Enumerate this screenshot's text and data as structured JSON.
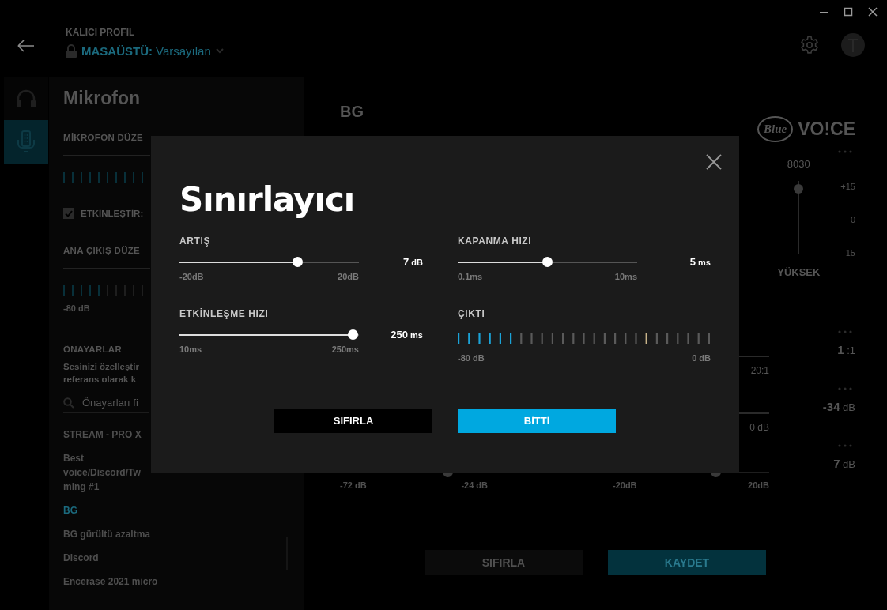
{
  "header": {
    "profile_label": "KALICI PROFIL",
    "profile_prefix": "MASAÜSTÜ:",
    "profile_name": "Varsayılan"
  },
  "nav": [
    {
      "kind": "headphones",
      "selected": false
    },
    {
      "kind": "microphone",
      "selected": true
    }
  ],
  "left_panel": {
    "title": "Mikrofon",
    "mic_level_label": "MİKROFON DÜZE",
    "enable": {
      "label": "ETKİNLEŞTİR:",
      "checked": true
    },
    "output_label": "ANA ÇIKIŞ DÜZE",
    "output_min": "-80 dB",
    "presets_title": "ÖNAYARLAR",
    "presets_description": [
      "Sesinizi özelleştir",
      "referans olarak k"
    ],
    "search_placeholder": "Önayarları fi",
    "presets": [
      {
        "lines": [
          "STREAM - PRO X"
        ],
        "selected": false
      },
      {
        "lines": [
          "Best",
          "voice/Discord/Tw",
          "ming #1"
        ],
        "selected": false
      },
      {
        "lines": [
          "BG"
        ],
        "selected": true
      },
      {
        "lines": [
          "BG gürültü azaltma"
        ],
        "selected": false
      },
      {
        "lines": [
          "Discord"
        ],
        "selected": false
      },
      {
        "lines": [
          "Encerase 2021 micro"
        ],
        "selected": false
      }
    ]
  },
  "main": {
    "title": "BG",
    "logo": {
      "badge": "Blue",
      "word": "VO!CE"
    },
    "eq": {
      "band": "8030",
      "level": 0.9,
      "scale": [
        "+15",
        "0",
        "-15"
      ],
      "band_label": "YÜKSEK"
    },
    "rows": [
      {
        "kind": "line",
        "value": "**1** :1",
        "label_end": "20:1"
      },
      {
        "kind": "line",
        "value": "**-34** dB",
        "label_end": "0 dB"
      },
      {
        "kind": "slider",
        "value": "**7** dB",
        "level": 0.66,
        "min": "-20dB",
        "max": "20dB",
        "left": {
          "level": 0.73,
          "min": "-72 dB",
          "max": "-24 dB"
        }
      }
    ],
    "buttons": [
      {
        "label": "SIFIRLA",
        "kind": "secondary"
      },
      {
        "label": "KAYDET",
        "kind": "primary"
      }
    ]
  },
  "dialog": {
    "title": "Sınırlayıcı",
    "controls": [
      {
        "kind": "slider",
        "label": "ARTIŞ",
        "value": "**7** dB",
        "level": 0.66,
        "min": "-20dB",
        "max": "20dB"
      },
      {
        "kind": "slider",
        "label": "KAPANMA HIZI",
        "value": "**5** ms",
        "level": 0.5,
        "min": "0.1ms",
        "max": "10ms"
      },
      {
        "kind": "slider",
        "label": "ETKİNLEŞME HIZI",
        "value": "**250** ms",
        "level": 0.965,
        "min": "10ms",
        "max": "250ms"
      },
      {
        "kind": "meter",
        "label": "ÇIKTI",
        "min": "-80 dB",
        "max": "0 dB",
        "ticks": [
          {
            "color": "#1ba3d8"
          },
          {
            "color": "#1ba3d8"
          },
          {
            "color": "#1ba3d8"
          },
          {
            "color": "#1ba3d8"
          },
          {
            "color": "#1ba3d8"
          },
          {
            "color": "#1ba3d8"
          },
          {
            "color": "#5a5a5a"
          },
          {
            "color": "#5a5a5a"
          },
          {
            "color": "#5a5a5a"
          },
          {
            "color": "#5a5a5a"
          },
          {
            "color": "#5a5a5a"
          },
          {
            "color": "#5a5a5a"
          },
          {
            "color": "#5a5a5a"
          },
          {
            "color": "#5a5a5a"
          },
          {
            "color": "#5a5a5a"
          },
          {
            "color": "#5a5a5a"
          },
          {
            "color": "#5a5a5a"
          },
          {
            "color": "#5a5a5a"
          },
          {
            "color": "#c8b48a"
          },
          {
            "color": "#5a5a5a"
          },
          {
            "color": "#5a5a5a"
          },
          {
            "color": "#5a5a5a"
          },
          {
            "color": "#5a5a5a"
          },
          {
            "color": "#5a5a5a"
          },
          {
            "color": "#5a5a5a"
          }
        ]
      }
    ],
    "buttons": [
      {
        "label": "SIFIRLA",
        "kind": "secondary"
      },
      {
        "label": "BİTTİ",
        "kind": "primary"
      }
    ]
  }
}
